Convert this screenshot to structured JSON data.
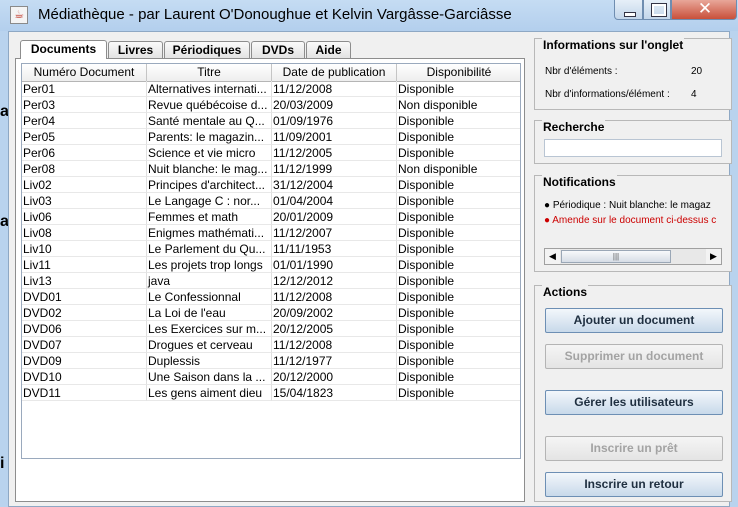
{
  "window": {
    "title": "Médiathèque - par Laurent O'Donoughue et Kelvin Vargâsse-Garciâsse",
    "close_glyph": "✕"
  },
  "left_peek": {
    "a1": "a",
    "a2": "a",
    "i": "i"
  },
  "tabs": [
    "Documents",
    "Livres",
    "Périodiques",
    "DVDs",
    "Aide"
  ],
  "table": {
    "columns": [
      "Numéro Document",
      "Titre",
      "Date de publication",
      "Disponibilité"
    ],
    "rows": [
      [
        "Per01",
        "Alternatives internati...",
        "11/12/2008",
        "Disponible"
      ],
      [
        "Per03",
        "Revue québécoise d...",
        "20/03/2009",
        "Non disponible"
      ],
      [
        "Per04",
        "Santé mentale au Q...",
        "01/09/1976",
        "Disponible"
      ],
      [
        "Per05",
        "Parents: le magazin...",
        "11/09/2001",
        "Disponible"
      ],
      [
        "Per06",
        "Science et vie micro",
        "11/12/2005",
        "Disponible"
      ],
      [
        "Per08",
        "Nuit blanche: le mag...",
        "11/12/1999",
        "Non disponible"
      ],
      [
        "Liv02",
        "Principes d'architect...",
        "31/12/2004",
        "Disponible"
      ],
      [
        "Liv03",
        "Le Langage C : nor...",
        "01/04/2004",
        "Disponible"
      ],
      [
        "Liv06",
        "Femmes et math",
        "20/01/2009",
        "Disponible"
      ],
      [
        "Liv08",
        "Enigmes mathémati...",
        "11/12/2007",
        "Disponible"
      ],
      [
        "Liv10",
        "Le Parlement du Qu...",
        "11/11/1953",
        "Disponible"
      ],
      [
        "Liv11",
        "Les projets trop longs",
        "01/01/1990",
        "Disponible"
      ],
      [
        "Liv13",
        "java",
        "12/12/2012",
        "Disponible"
      ],
      [
        "DVD01",
        "Le Confessionnal",
        "11/12/2008",
        "Disponible"
      ],
      [
        "DVD02",
        "La Loi de l'eau",
        "20/09/2002",
        "Disponible"
      ],
      [
        "DVD06",
        "Les Exercices sur m...",
        "20/12/2005",
        "Disponible"
      ],
      [
        "DVD07",
        "Drogues et cerveau",
        "11/12/2008",
        "Disponible"
      ],
      [
        "DVD09",
        "Duplessis",
        "11/12/1977",
        "Disponible"
      ],
      [
        "DVD10",
        "Une Saison dans la ...",
        "20/12/2000",
        "Disponible"
      ],
      [
        "DVD11",
        "Les gens aiment dieu",
        "15/04/1823",
        "Disponible"
      ]
    ]
  },
  "info": {
    "title": "Informations sur l'onglet",
    "nb_elements_label": "Nbr d'éléments :",
    "nb_elements_value": "20",
    "nb_info_label": "Nbr d'informations/élément :",
    "nb_info_value": "4"
  },
  "search": {
    "title": "Recherche",
    "value": ""
  },
  "notifications": {
    "title": "Notifications",
    "items": [
      {
        "text": "● Périodique : Nuit blanche: le magaz",
        "color": "#000000"
      },
      {
        "text": "● Amende sur le document ci-dessus c",
        "color": "#cc0000"
      }
    ],
    "scroll_left": "◀",
    "scroll_right": "▶",
    "thumb_grip": "|||"
  },
  "actions": {
    "title": "Actions",
    "buttons": [
      {
        "label": "Ajouter un document",
        "enabled": true
      },
      {
        "label": "Supprimer un document",
        "enabled": false
      },
      {
        "label": "Gérer les utilisateurs",
        "enabled": true
      },
      {
        "label": "Inscrire un prêt",
        "enabled": false
      },
      {
        "label": "Inscrire un retour",
        "enabled": true
      }
    ]
  }
}
